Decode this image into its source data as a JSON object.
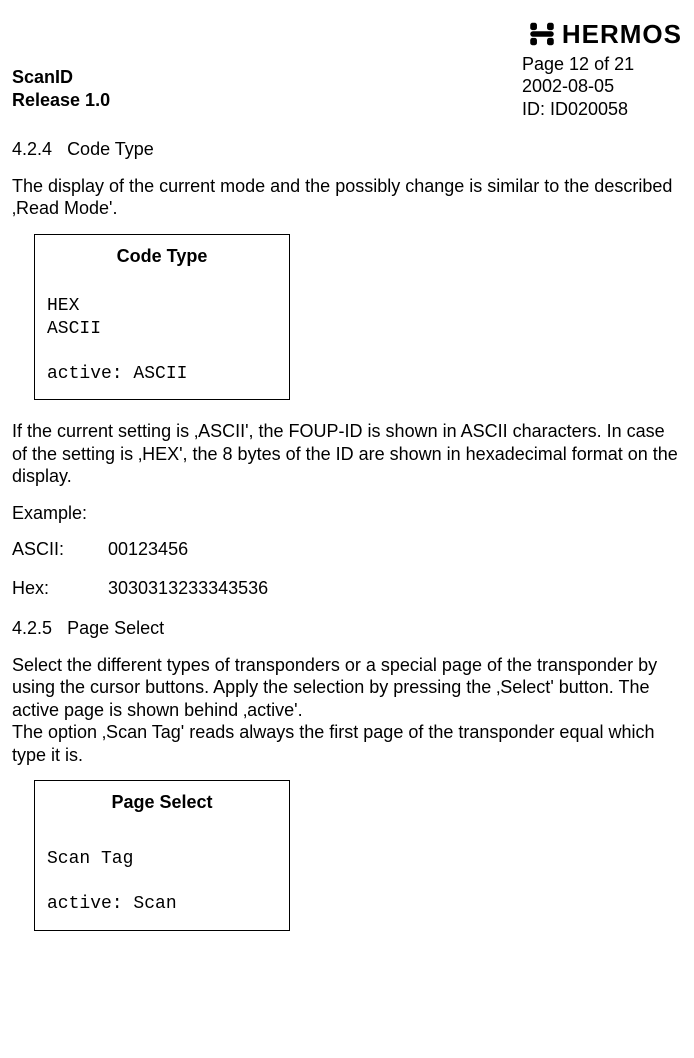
{
  "header": {
    "scanid": "ScanID",
    "release": "Release 1.0",
    "logo_text": "HERMOS",
    "page_label_prefix": "Page ",
    "page_current": "12",
    "page_of": " of ",
    "page_total": "21",
    "date": "2002-08-05",
    "doc_id": "ID: ID020058"
  },
  "section424": {
    "number": "4.2.4",
    "title": "Code Type",
    "intro": "The display of the current mode and the possibly change is similar to the described ‚Read Mode'.",
    "box_title": "Code  Type",
    "box_body": "HEX\nASCII\n\nactive: ASCII",
    "after_box": "If the current setting is ‚ASCII', the FOUP-ID is shown in ASCII characters. In case of the setting is ‚HEX', the 8 bytes of the ID are shown in hexadecimal format on the display.",
    "example_label": "Example:",
    "ascii_label": "ASCII:",
    "ascii_value": "00123456",
    "hex_label": "Hex:",
    "hex_value": "3030313233343536"
  },
  "section425": {
    "number": "4.2.5",
    "title": "Page Select",
    "para1": "Select the different types of transponders or a special page of the transponder by using the cursor buttons. Apply the selection by pressing the ‚Select' button. The active page is shown behind ‚active'.",
    "para2": "The option ‚Scan Tag' reads always the first page of the transponder equal which type it is.",
    "box_title": "Page Select",
    "box_body": "\nScan Tag\n\nactive: Scan"
  }
}
